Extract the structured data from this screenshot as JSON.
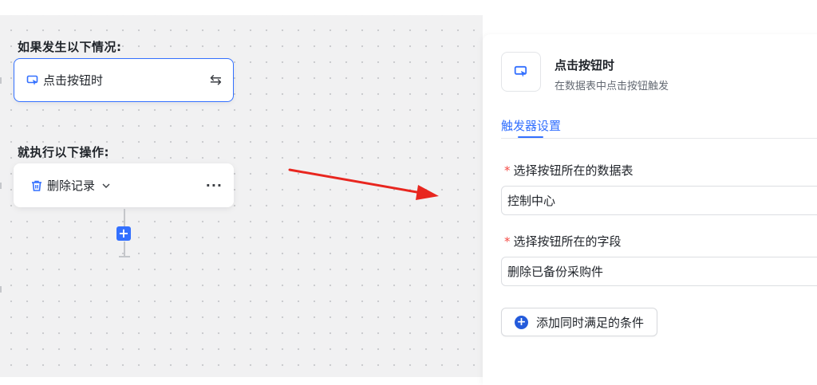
{
  "canvas": {
    "if_title": "如果发生以下情况:",
    "then_title": "就执行以下操作:",
    "trigger": {
      "label": "点击按钮时",
      "swap_icon": "⇆",
      "icon": "button-click-icon"
    },
    "action": {
      "label": "删除记录",
      "more_icon": "···",
      "icon": "trash-icon"
    },
    "add_step": "+"
  },
  "panel": {
    "title": "点击按钮时",
    "subtitle": "在数据表中点击按钮触发",
    "tab_label": "触发器设置",
    "table_field": {
      "required_mark": "*",
      "label": "选择按钮所在的数据表",
      "value": "控制中心"
    },
    "button_field": {
      "required_mark": "*",
      "label": "选择按钮所在的字段",
      "value": "删除已备份采购件"
    },
    "add_condition": {
      "icon": "+",
      "label": "添加同时满足的条件"
    }
  },
  "colors": {
    "accent": "#3370ff",
    "annotation_arrow": "#e8261f",
    "required": "#f54a45"
  }
}
